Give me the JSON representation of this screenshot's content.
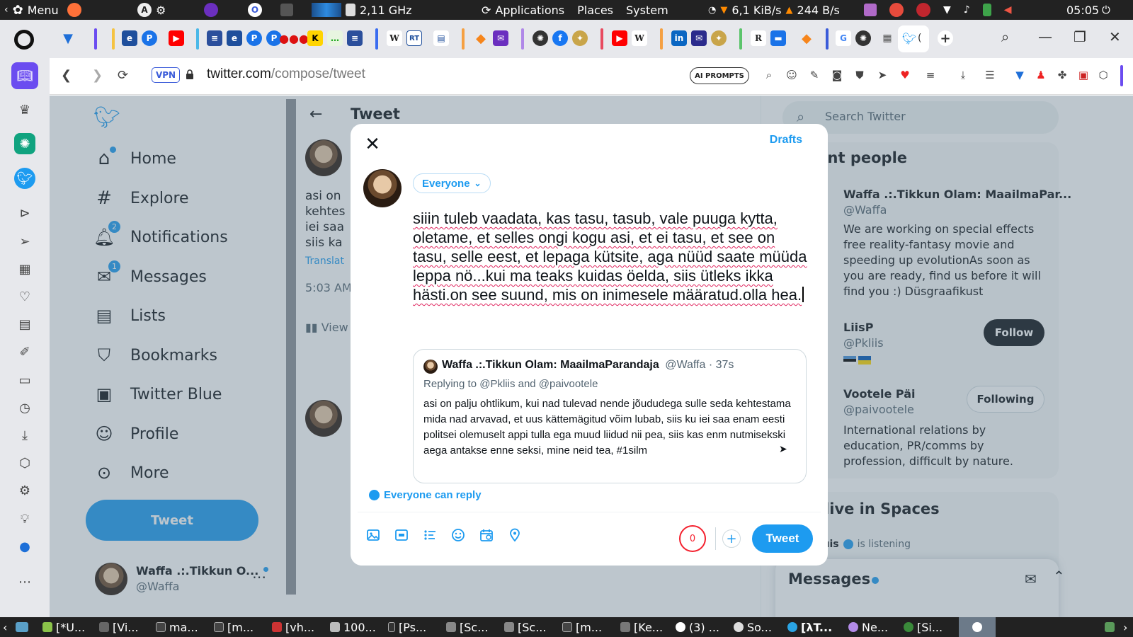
{
  "os_top": {
    "menu_label": "Menu",
    "cpu_freq": "2,11 GHz",
    "menus": [
      "Applications",
      "Places",
      "System"
    ],
    "net_down": "6,1 KiB/s",
    "net_up": "244 B/s",
    "clock": "05:05"
  },
  "browser": {
    "url_host": "twitter.com",
    "url_path": "/compose/tweet",
    "vpn_label": "VPN",
    "ai_prompts_label": "AI PROMPTS",
    "active_tab_title": "("
  },
  "nav": {
    "items": [
      {
        "label": "Home",
        "icon": "home-icon"
      },
      {
        "label": "Explore",
        "icon": "hashtag-icon"
      },
      {
        "label": "Notifications",
        "icon": "bell-icon",
        "badge": "2"
      },
      {
        "label": "Messages",
        "icon": "envelope-icon",
        "badge": "1"
      },
      {
        "label": "Lists",
        "icon": "list-icon"
      },
      {
        "label": "Bookmarks",
        "icon": "bookmark-icon"
      },
      {
        "label": "Twitter Blue",
        "icon": "twitter-blue-icon"
      },
      {
        "label": "Profile",
        "icon": "person-icon"
      },
      {
        "label": "More",
        "icon": "more-circle-icon"
      }
    ],
    "tweet_button": "Tweet",
    "account_name": "Waffa .:.Tikkun O...",
    "account_handle": "@Waffa"
  },
  "center": {
    "title": "Tweet",
    "snippet": [
      "asi on",
      "kehtes",
      "iei saa",
      "siis ka"
    ],
    "translate": "Translat",
    "time": "5:03 AM",
    "views": "View"
  },
  "right": {
    "search_placeholder": "Search Twitter",
    "relevant_title": "elevant people",
    "people": [
      {
        "name": "Waffa .:.Tikkun Olam: MaailmaPar...",
        "handle": "@Waffa",
        "bio": "We are working on special effects free reality-fantasy movie and speeding up evolutionAs soon as you are ready, find us before it will find you :) Düsgraafikust"
      },
      {
        "name": "LiisP",
        "handle": "@Pkliis",
        "button": "Follow"
      },
      {
        "name": "Vootele Päi",
        "handle": "@paivootele",
        "button": "Following",
        "bio": "International relations by education, PR/comms by profession, difficult by nature."
      }
    ],
    "spaces_title": "sten live in Spaces",
    "spaces_listener": "DroneLuis",
    "spaces_status": "is listening",
    "messages_title": "Messages"
  },
  "modal": {
    "drafts": "Drafts",
    "audience": "Everyone",
    "text": "siiin tuleb vaadata, kas tasu, tasub, vale puuga kytta, oletame, et selles ongi kogu asi, et ei tasu, et see on tasu, selle eest, et lepaga kütsite, aga nüüd saate müüda leppa nö...kui ma teaks kuidas öelda, siis ütleks ikka hästi.on see suund, mis on inimesele määratud.olla hea.",
    "quote": {
      "name": "Waffa .:.Tikkun Olam: MaailmaParandaja",
      "handle": "@Waffa",
      "time": "37s",
      "replying": "Replying to @Pkliis and @paivootele",
      "text": "asi on palju ohtlikum, kui nad tulevad nende jõududega sulle seda kehtestama mida nad arvavad, et uus kättemägitud võim lubab, siis ku iei saa enam eesti politsei olemuselt appi tulla ega muud liidud nii pea, siis kas enm nutmisekski aega antakse enne seksi, mine neid tea, #1silm"
    },
    "reply_setting": "Everyone can reply",
    "char_count": "0",
    "tweet_button": "Tweet"
  },
  "taskbar": {
    "tasks": [
      "[*U...",
      "[Vi...",
      "ma...",
      "[m...",
      "[vh...",
      "100...",
      "[Ps...",
      "[Sc...",
      "[Sc...",
      "[m...",
      "[Ke...",
      "(3) ...",
      "So...",
      "[λT...",
      "Ne...",
      "[Si..."
    ]
  },
  "colors": {
    "twitter_blue": "#1d9bf0",
    "counter_red": "#f4212e",
    "overlay": "rgba(91,112,131,0.4)"
  }
}
